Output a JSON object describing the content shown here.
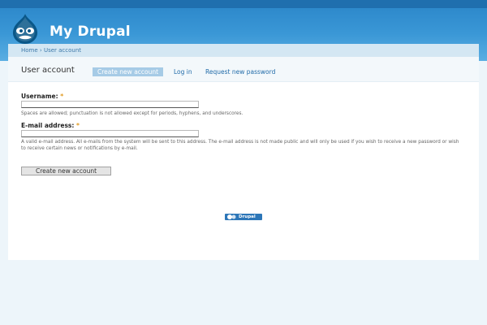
{
  "header": {
    "site_name": "My Drupal",
    "logo_icon": "drupal-drop-icon"
  },
  "breadcrumb": {
    "home": "Home",
    "separator": "›",
    "current": "User account"
  },
  "page": {
    "title": "User account"
  },
  "tabs": [
    {
      "label": "Create new account",
      "active": true
    },
    {
      "label": "Log in",
      "active": false
    },
    {
      "label": "Request new password",
      "active": false
    }
  ],
  "form": {
    "username": {
      "label": "Username:",
      "required_mark": "*",
      "value": "",
      "description": "Spaces are allowed; punctuation is not allowed except for periods, hyphens, and underscores."
    },
    "email": {
      "label": "E-mail address:",
      "required_mark": "*",
      "value": "",
      "description": "A valid e-mail address. All e-mails from the system will be sent to this address. The e-mail address is not made public and will only be used if you wish to receive a new password or wish to receive certain news or notifications by e-mail."
    },
    "submit_label": "Create new account"
  },
  "footer": {
    "powered_by": "Drupal"
  },
  "colors": {
    "header_blue": "#2a85c8",
    "link_blue": "#1f6aa8",
    "required": "#e19b23",
    "active_tab": "#a6cbe6"
  }
}
